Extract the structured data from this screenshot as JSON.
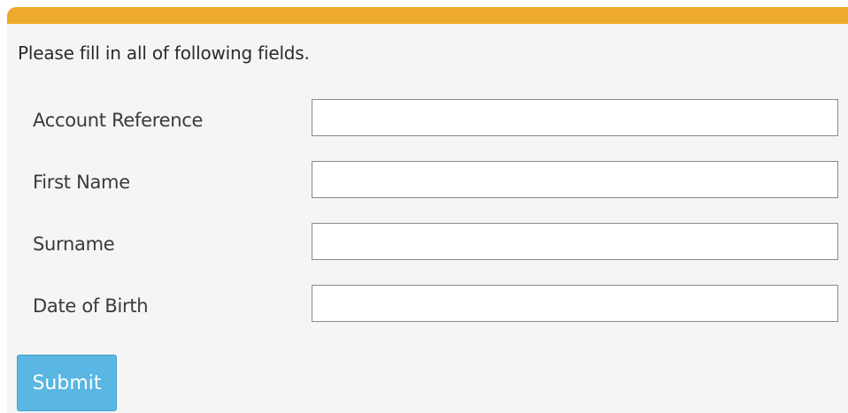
{
  "header": {
    "accent_color": "#eeaa2a"
  },
  "form": {
    "instruction": "Please fill in all of following fields.",
    "fields": [
      {
        "label": "Account Reference",
        "value": ""
      },
      {
        "label": "First Name",
        "value": ""
      },
      {
        "label": "Surname",
        "value": ""
      },
      {
        "label": "Date of Birth",
        "value": ""
      }
    ],
    "submit_label": "Submit",
    "submit_color": "#5ab6e3"
  }
}
